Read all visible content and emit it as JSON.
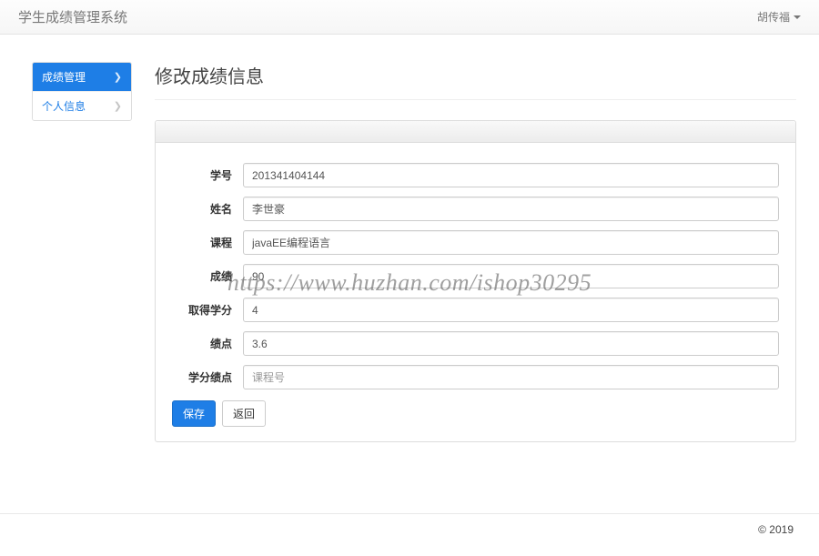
{
  "navbar": {
    "brand": "学生成绩管理系统",
    "user": "胡传福"
  },
  "sidebar": {
    "items": [
      {
        "label": "成绩管理",
        "active": true
      },
      {
        "label": "个人信息",
        "active": false
      }
    ]
  },
  "page": {
    "title": "修改成绩信息"
  },
  "form": {
    "fields": [
      {
        "label": "学号",
        "value": "201341404144"
      },
      {
        "label": "姓名",
        "value": "李世豪"
      },
      {
        "label": "课程",
        "value": "javaEE编程语言"
      },
      {
        "label": "成绩",
        "value": "90"
      },
      {
        "label": "取得学分",
        "value": "4"
      },
      {
        "label": "绩点",
        "value": "3.6"
      },
      {
        "label": "学分绩点",
        "value": "",
        "placeholder": "课程号"
      }
    ],
    "save_label": "保存",
    "back_label": "返回"
  },
  "watermark": "https://www.huzhan.com/ishop30295",
  "footer": {
    "copyright": "© 2019"
  }
}
